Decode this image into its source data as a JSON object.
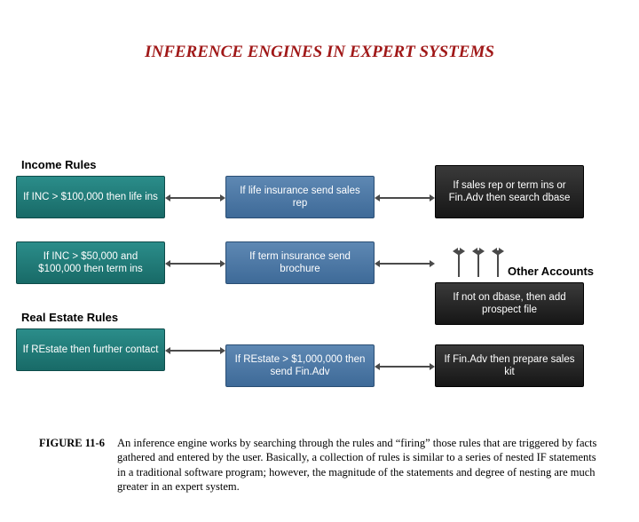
{
  "title": "INFERENCE ENGINES IN EXPERT SYSTEMS",
  "labels": {
    "income": "Income Rules",
    "real_estate": "Real Estate Rules",
    "other": "Other Accounts"
  },
  "boxes": {
    "b1": "If INC > $100,000 then life ins",
    "b2": "If life insurance send sales rep",
    "b3": "If sales rep or term ins or Fin.Adv then search dbase",
    "b4": "If INC > $50,000 and $100,000 then term ins",
    "b5": "If term insurance send brochure",
    "b6": "If not on dbase, then add prospect file",
    "b7": "If REstate then further contact",
    "b8": "If REstate > $1,000,000 then send Fin.Adv",
    "b9": "If Fin.Adv then prepare sales kit"
  },
  "caption": {
    "label": "FIGURE 11-6",
    "text": "An inference engine works by searching through the rules and “firing” those rules that are triggered by facts gathered and entered by the user. Basically, a collection of rules is similar to a series of nested IF statements in a traditional software program; however, the magnitude of the statements and degree of nesting are much greater in an expert system."
  }
}
